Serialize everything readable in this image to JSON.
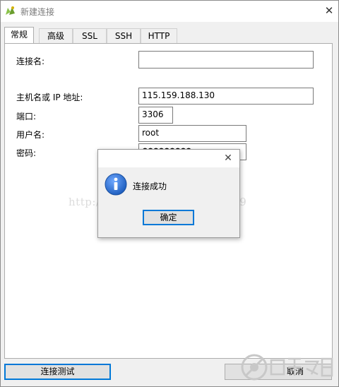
{
  "window": {
    "title": "新建连接"
  },
  "tabs": [
    "常规",
    "高级",
    "SSL",
    "SSH",
    "HTTP"
  ],
  "form": {
    "connection_name": {
      "label": "连接名:",
      "value": ""
    },
    "host": {
      "label": "主机名或 IP 地址:",
      "value": "115.159.188.130"
    },
    "port": {
      "label": "端口:",
      "value": "3306"
    },
    "username": {
      "label": "用户名:",
      "value": "root"
    },
    "password": {
      "label": "密码:",
      "value": "●●●●●●●●●"
    }
  },
  "watermark": "http://blog.csdn.net/wjx342529",
  "dialog": {
    "message": "连接成功",
    "ok_label": "确定"
  },
  "footer": {
    "test_button": "连接测试",
    "cancel_button": "取消"
  },
  "colors": {
    "focus_blue": "#0078d7",
    "info_blue": "#1f5fbf",
    "panel_border": "#adadad"
  },
  "icons": [
    "app-icon",
    "close-icon",
    "info-icon",
    "brand-logo"
  ]
}
